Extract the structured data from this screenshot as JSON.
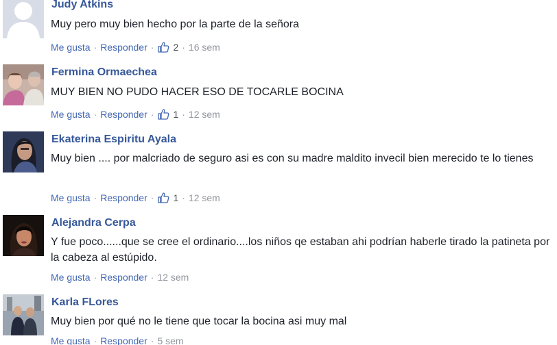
{
  "comments": [
    {
      "author": "Judy Atkins",
      "text": "Muy pero muy bien hecho por la parte de la señora",
      "like_label": "Me gusta",
      "reply_label": "Responder",
      "likes": "2",
      "time": "16 sem",
      "avatar_icon": "default-profile-silhouette"
    },
    {
      "author": "Fermina Ormaechea",
      "text": "MUY BIEN NO PUDO HACER ESO DE TOCARLE BOCINA",
      "like_label": "Me gusta",
      "reply_label": "Responder",
      "likes": "1",
      "time": "12 sem",
      "avatar_icon": "profile-photo"
    },
    {
      "author": "Ekaterina Espiritu Ayala",
      "text": "Muy bien .... por malcriado de seguro asi es con su madre maldito invecil bien merecido te lo tienes",
      "like_label": "Me gusta",
      "reply_label": "Responder",
      "likes": "1",
      "time": "12 sem",
      "avatar_icon": "profile-photo"
    },
    {
      "author": "Alejandra Cerpa",
      "text": "Y fue poco......que se cree el ordinario....los niños qe estaban ahi podrían haberle tirado la patineta por la cabeza al estúpido.",
      "like_label": "Me gusta",
      "reply_label": "Responder",
      "time": "12 sem",
      "avatar_icon": "profile-photo"
    },
    {
      "author": "Karla FLores",
      "text": "Muy bien por qué no le tiene que tocar la bocina asi muy mal",
      "like_label": "Me gusta",
      "reply_label": "Responder",
      "time": "5 sem",
      "avatar_icon": "profile-photo"
    }
  ],
  "colors": {
    "author": "#365899",
    "link": "#4267b2",
    "meta": "#90949c",
    "text": "#1d2129"
  }
}
